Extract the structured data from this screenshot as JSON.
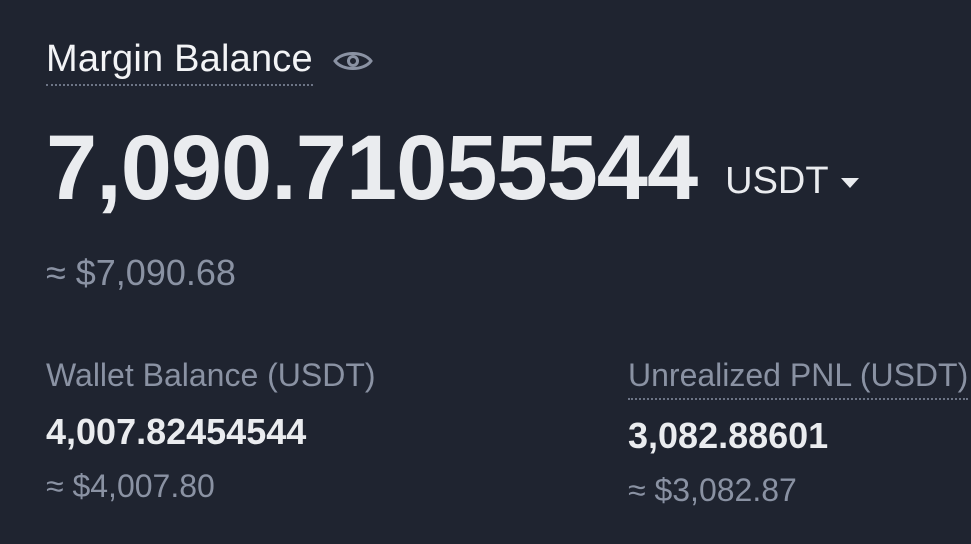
{
  "margin_balance": {
    "title": "Margin Balance",
    "eye_icon": "eye-icon",
    "value": "7,090.71055544",
    "currency": "USDT",
    "approx": "≈ $7,090.68"
  },
  "wallet_balance": {
    "label": "Wallet Balance (USDT)",
    "value": "4,007.82454544",
    "approx": "≈ $4,007.80"
  },
  "unrealized_pnl": {
    "label": "Unrealized PNL (USDT)",
    "value": "3,082.88601",
    "approx": "≈ $3,082.87"
  },
  "colors": {
    "background": "#1f2430",
    "primary_text": "#eaecef",
    "secondary_text": "#8a92a3"
  }
}
